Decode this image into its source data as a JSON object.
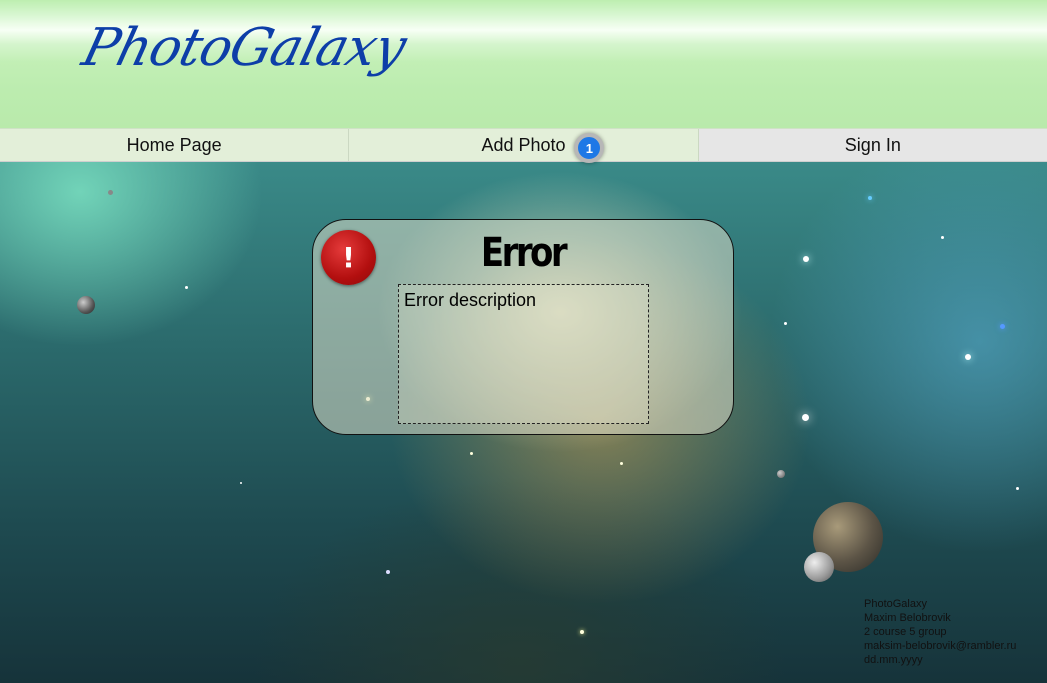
{
  "header": {
    "logo": "PhotoGalaxy"
  },
  "nav": {
    "items": [
      {
        "label": "Home Page"
      },
      {
        "label": "Add Photo"
      },
      {
        "label": "Sign In"
      }
    ],
    "badge_count": "1"
  },
  "dialog": {
    "icon_glyph": "!",
    "title": "Error",
    "description": "Error description"
  },
  "footer": {
    "lines": [
      "PhotoGalaxy",
      "Maxim Belobrovik",
      "2 course 5 group",
      "maksim-belobrovik@rambler.ru",
      "dd.mm.yyyy"
    ]
  },
  "colors": {
    "header_green": "#bdeeb0",
    "logo_blue": "#0d3ea8",
    "badge_blue": "#1e78e6",
    "error_red": "#b30f0f"
  }
}
